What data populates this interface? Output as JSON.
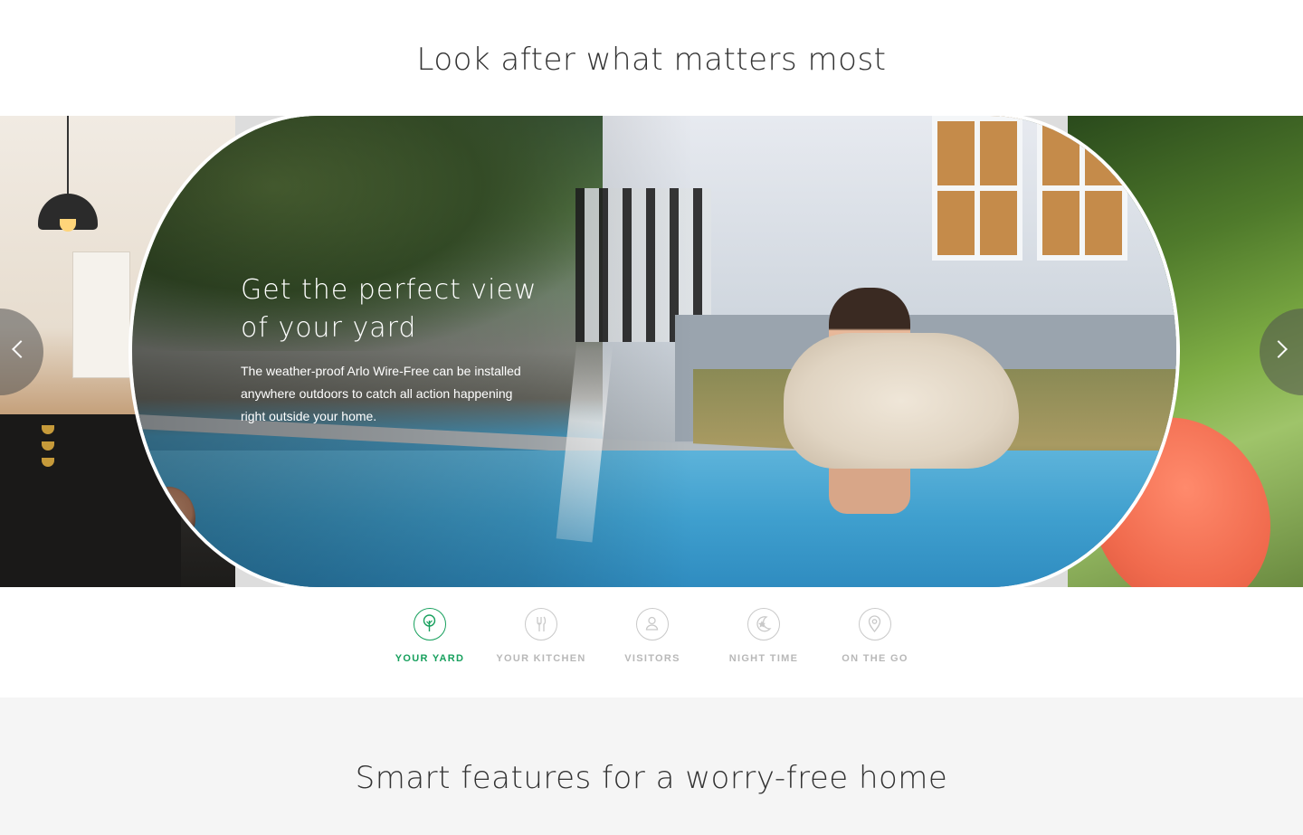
{
  "header": {
    "title": "Look after what matters most"
  },
  "slide": {
    "heading_line1": "Get the perfect view",
    "heading_line2": "of your yard",
    "text_line1": "The weather-proof Arlo Wire-Free can be installed",
    "text_line2": "anywhere outdoors to catch all action happening",
    "text_line3": "right outside your home."
  },
  "tabs": [
    {
      "label": "YOUR YARD",
      "icon": "tree-icon",
      "active": true
    },
    {
      "label": "YOUR KITCHEN",
      "icon": "utensils-icon",
      "active": false
    },
    {
      "label": "VISITORS",
      "icon": "person-icon",
      "active": false
    },
    {
      "label": "NIGHT TIME",
      "icon": "star-moon-icon",
      "active": false
    },
    {
      "label": "ON THE GO",
      "icon": "location-pin-icon",
      "active": false
    }
  ],
  "features": {
    "title": "Smart features for a worry-free home"
  },
  "colors": {
    "accent": "#17a05d",
    "inactive": "#b8b8b8",
    "lower_bg": "#f5f5f5"
  }
}
